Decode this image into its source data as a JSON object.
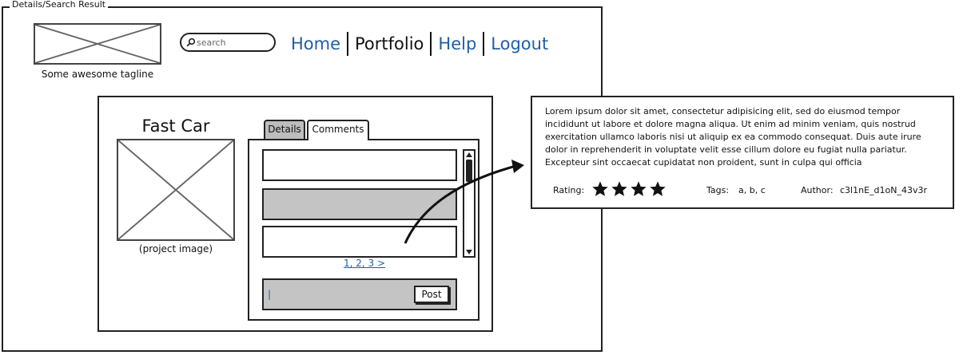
{
  "window": {
    "title": "Details/Search Result"
  },
  "header": {
    "tagline": "Some awesome tagline",
    "search_placeholder": "search",
    "nav": [
      "Home",
      "Portfolio",
      "Help",
      "Logout"
    ],
    "current_nav": "Portfolio"
  },
  "project": {
    "title": "Fast Car",
    "image_caption": "(project image)"
  },
  "tabs": [
    {
      "label": "Details",
      "selected": false
    },
    {
      "label": "Comments",
      "selected": true
    }
  ],
  "comments": {
    "items": [
      "",
      "",
      ""
    ],
    "pagination": "1, 2, 3 >",
    "input_value": "|",
    "post_label": "Post"
  },
  "comment_detail": {
    "text": "Lorem ipsum dolor sit amet, consectetur adipisicing elit, sed do eiusmod tempor incididunt ut labore et dolore magna aliqua. Ut enim ad minim veniam, quis nostrud exercitation ullamco laboris nisi ut aliquip ex ea commodo consequat. Duis aute irure dolor in reprehenderit in voluptate velit esse cillum dolore eu fugiat nulla pariatur. Excepteur sint occaecat cupidatat non proident, sunt in culpa qui officia",
    "rating_label": "Rating:",
    "rating": 4,
    "tags_label": "Tags:",
    "tags": "a, b, c",
    "author_label": "Author:",
    "author": "c3l1nE_d1oN_43v3r"
  },
  "colors": {
    "link": "#1f5fa6",
    "panel_gray": "#c4c4c4"
  }
}
